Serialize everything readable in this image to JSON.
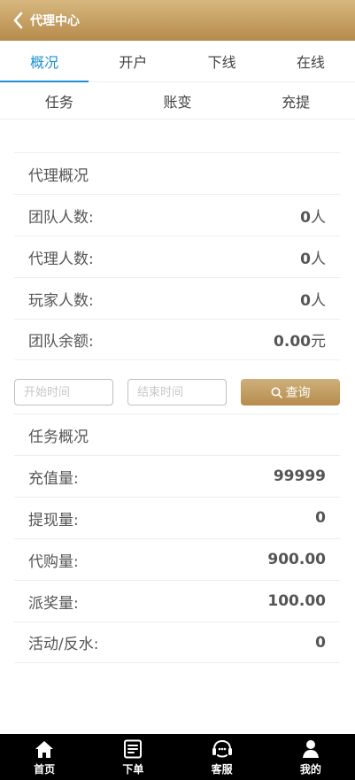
{
  "header": {
    "title": "代理中心"
  },
  "tabs": [
    {
      "label": "概况",
      "active": true
    },
    {
      "label": "开户",
      "active": false
    },
    {
      "label": "下线",
      "active": false
    },
    {
      "label": "在线",
      "active": false
    }
  ],
  "subtabs": [
    {
      "label": "任务"
    },
    {
      "label": "账变"
    },
    {
      "label": "充提"
    }
  ],
  "agent_overview": {
    "title": "代理概况",
    "rows": [
      {
        "label": "团队人数:",
        "value": "0",
        "unit": "人"
      },
      {
        "label": "代理人数:",
        "value": "0",
        "unit": "人"
      },
      {
        "label": "玩家人数:",
        "value": "0",
        "unit": "人"
      },
      {
        "label": "团队余额:",
        "value": "0.00",
        "unit": "元"
      }
    ]
  },
  "filters": {
    "start_placeholder": "开始时间",
    "end_placeholder": "结束时间",
    "query_label": "查询"
  },
  "task_overview": {
    "title": "任务概况",
    "rows": [
      {
        "label": "充值量:",
        "value": "99999"
      },
      {
        "label": "提现量:",
        "value": "0"
      },
      {
        "label": "代购量:",
        "value": "900.00"
      },
      {
        "label": "派奖量:",
        "value": "100.00"
      },
      {
        "label": "活动/反水:",
        "value": "0"
      }
    ]
  },
  "bottom_nav": [
    {
      "label": "首页"
    },
    {
      "label": "下单"
    },
    {
      "label": "客服"
    },
    {
      "label": "我的"
    }
  ]
}
